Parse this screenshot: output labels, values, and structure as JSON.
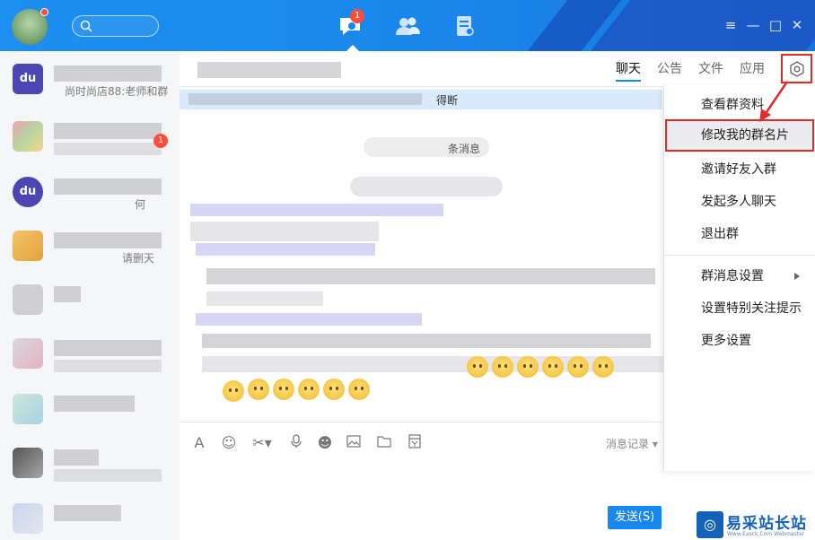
{
  "titlebar": {
    "messages_badge": "1",
    "icons": [
      "search-icon",
      "messages-icon",
      "contacts-icon",
      "files-icon",
      "menu-icon",
      "minimize-icon",
      "maximize-icon",
      "close-icon"
    ]
  },
  "sidebar": {
    "items": [
      {
        "preview": "尚时尚店88:老师和群"
      },
      {
        "badge": "1"
      },
      {
        "preview": "何"
      },
      {
        "preview": "请删天"
      }
    ]
  },
  "chat": {
    "notice_text": "得断",
    "tip_text": "条消息",
    "history_label": "消息记录",
    "send_label": "发送(S)"
  },
  "tabs": [
    "聊天",
    "公告",
    "文件",
    "应用"
  ],
  "menu": {
    "items": [
      "查看群资料",
      "修改我的群名片",
      "邀请好友入群",
      "发起多人聊天",
      "退出群",
      "群消息设置",
      "设置特别关注提示",
      "更多设置"
    ],
    "highlighted": "修改我的群名片"
  },
  "watermark": {
    "title": "易采站长站",
    "subtitle": "Www.Easck.Com  Webmaster"
  },
  "colors": {
    "accent": "#1787f2",
    "highlight_border": "#e02b2b",
    "titlebar": "#1a86ec"
  }
}
